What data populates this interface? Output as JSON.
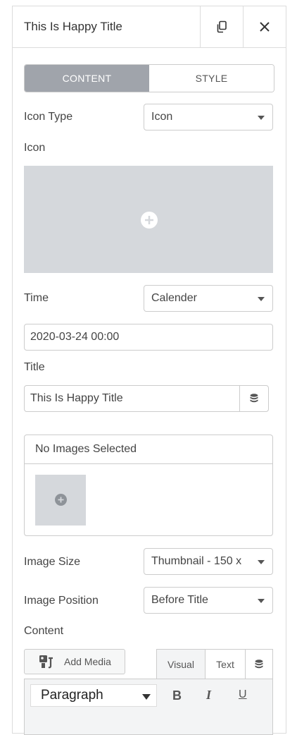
{
  "header": {
    "title": "This Is Happy Title"
  },
  "tabs": [
    {
      "label": "CONTENT",
      "active": true
    },
    {
      "label": "STYLE",
      "active": false
    }
  ],
  "fields": {
    "icon_type": {
      "label": "Icon Type",
      "value": "Icon"
    },
    "icon": {
      "label": "Icon"
    },
    "time": {
      "label": "Time",
      "value": "Calender"
    },
    "date_value": "2020-03-24 00:00",
    "title": {
      "label": "Title",
      "value": "This Is Happy Title"
    },
    "gallery": {
      "empty_text": "No Images Selected"
    },
    "image_size": {
      "label": "Image Size",
      "value": "Thumbnail - 150 x"
    },
    "image_position": {
      "label": "Image Position",
      "value": "Before Title"
    },
    "content": {
      "label": "Content"
    }
  },
  "editor": {
    "add_media_label": "Add Media",
    "tabs": [
      "Visual",
      "Text"
    ],
    "format_value": "Paragraph",
    "bold": "B",
    "italic": "I",
    "underline": "U"
  },
  "colors": {
    "active_tab": "#a0a4ab",
    "placeholder_bg": "#d5d8dc"
  },
  "icons": [
    "copy-icon",
    "close-icon",
    "plus-icon",
    "database-icon",
    "media-icon"
  ]
}
